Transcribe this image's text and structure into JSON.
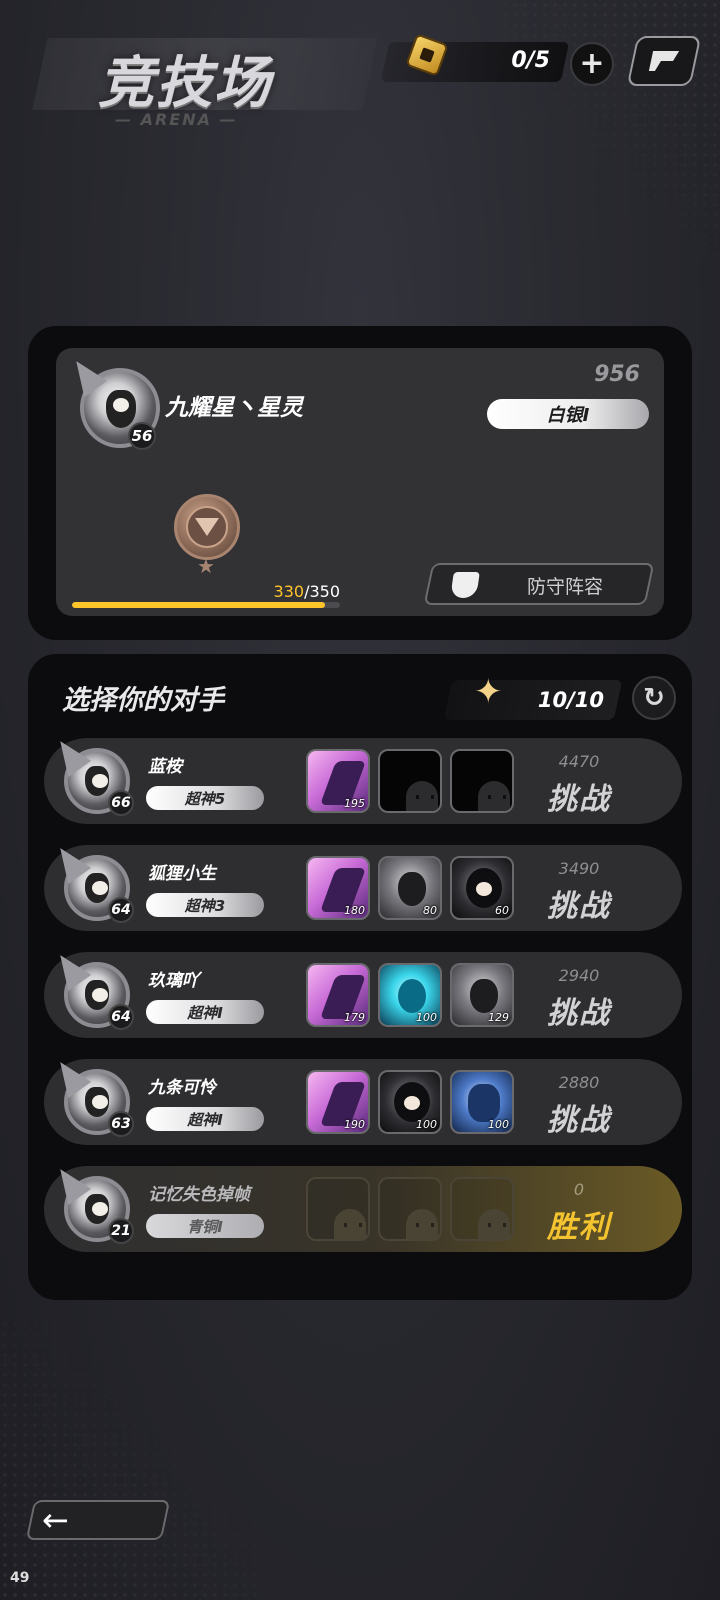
{
  "header": {
    "title": "竞技场",
    "subtitle": "— ARENA —",
    "currency": "0/5",
    "plus_label": "+"
  },
  "player": {
    "name": "九耀星丶星灵",
    "level": "56",
    "score": "956",
    "rank": "白银I",
    "xp_current": "330",
    "xp_max": "350",
    "xp_fraction": 0.943,
    "defense_label": "防守阵容"
  },
  "opponents_panel": {
    "title": "选择你的对手",
    "tickets": "10/10",
    "refresh_icon": "refresh-icon"
  },
  "opponents": [
    {
      "name": "蓝桉",
      "level": "66",
      "rank": "超神5",
      "power": "4470",
      "action": "挑战",
      "team": [
        {
          "style": "pink",
          "level": "195"
        },
        {
          "style": "empty",
          "level": ""
        },
        {
          "style": "empty",
          "level": ""
        }
      ]
    },
    {
      "name": "狐狸小生",
      "level": "64",
      "rank": "超神3",
      "power": "3490",
      "action": "挑战",
      "team": [
        {
          "style": "pink",
          "level": "180"
        },
        {
          "style": "gray",
          "level": "80"
        },
        {
          "style": "dark",
          "level": "60"
        }
      ]
    },
    {
      "name": "玖璃吖",
      "level": "64",
      "rank": "超神I",
      "power": "2940",
      "action": "挑战",
      "team": [
        {
          "style": "pink",
          "level": "179"
        },
        {
          "style": "cyan",
          "level": "100"
        },
        {
          "style": "gray",
          "level": "129"
        }
      ]
    },
    {
      "name": "九条可怜",
      "level": "63",
      "rank": "超神I",
      "power": "2880",
      "action": "挑战",
      "team": [
        {
          "style": "pink",
          "level": "190"
        },
        {
          "style": "dark",
          "level": "100"
        },
        {
          "style": "blue",
          "level": "100"
        }
      ]
    },
    {
      "name": "记忆失色掉帧",
      "level": "21",
      "rank": "青铜I",
      "power": "0",
      "action": "胜利",
      "won": true,
      "team": [
        {
          "style": "empty",
          "level": ""
        },
        {
          "style": "empty",
          "level": ""
        },
        {
          "style": "empty",
          "level": ""
        }
      ]
    }
  ],
  "footer": {
    "back_icon": "back-arrow-icon",
    "corner_number": "49"
  },
  "colors": {
    "accent_gold": "#ffc42a",
    "win_gold": "#f4c430"
  }
}
